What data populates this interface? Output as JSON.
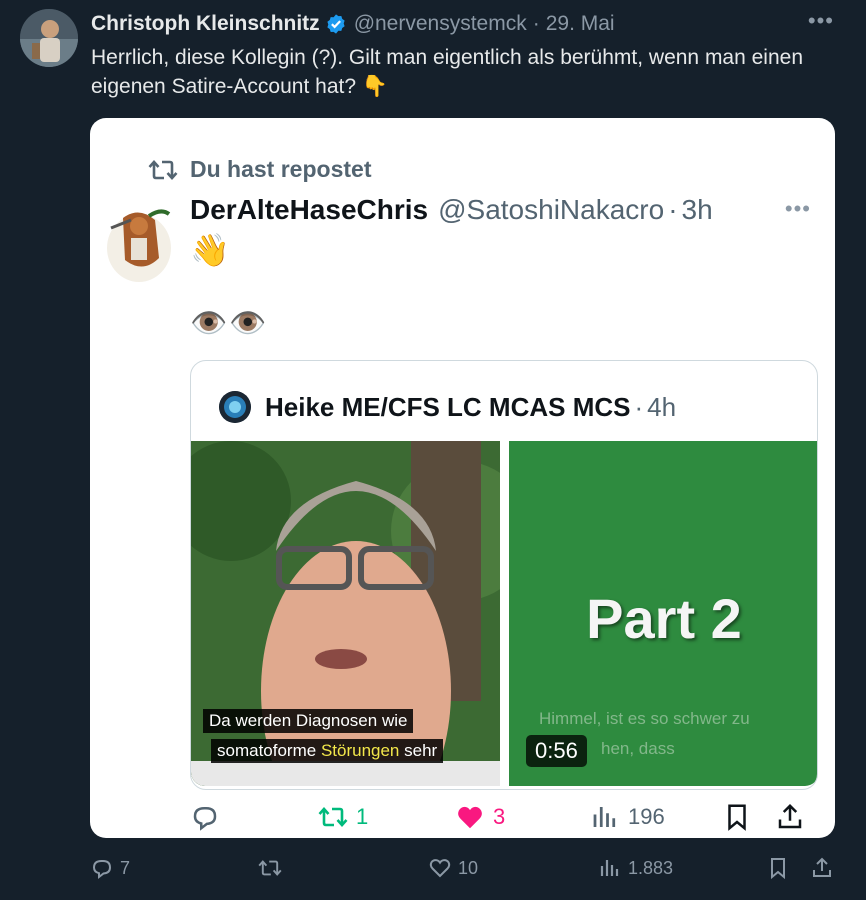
{
  "outer": {
    "author_name": "Christoph Kleinschnitz",
    "handle": "@nervensystemck",
    "date": "29. Mai",
    "text": "Herrlich, diese Kollegin (?). Gilt man eigentlich als berühmt, wenn man einen eigenen Satire-Account hat? 👇",
    "icons": [
      "verified-badge-icon",
      "more-icon"
    ],
    "actions": {
      "replies": "7",
      "reposts": "",
      "likes": "10",
      "views": "1.883"
    }
  },
  "card": {
    "repost_label": "Du hast repostet",
    "author_name": "DerAlteHaseChris",
    "handle": "@SatoshiNakacro",
    "time": "3h",
    "line1": "👋",
    "line2": "👁️👁️",
    "quote": {
      "author_name": "Heike ME/CFS LC MCAS MCS",
      "time": "4h",
      "left_subtitle_1": "Da werden Diagnosen wie",
      "left_subtitle_2a": "somatoforme ",
      "left_subtitle_2b": "Störungen",
      "left_subtitle_2c": " sehr",
      "right_title": "Part 2",
      "right_subtitle_1": "Himmel, ist es so schwer zu",
      "right_subtitle_2": "hen, dass",
      "duration": "0:56"
    },
    "actions": {
      "reposts": "1",
      "likes": "3",
      "views": "196"
    }
  },
  "colors": {
    "background": "#15202b",
    "card": "#ffffff",
    "repost_green": "#00ba7c",
    "like_pink": "#f91880",
    "verified_blue": "#1d9bf0",
    "muted": "#8b98a5"
  }
}
